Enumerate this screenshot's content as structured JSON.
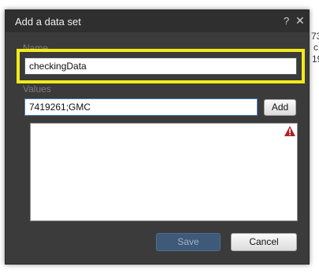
{
  "background": {
    "fragments": [
      "73",
      "c",
      "19"
    ]
  },
  "dialog": {
    "title": "Add a data set",
    "help_label": "?",
    "close_label": "✕",
    "name": {
      "label": "Name",
      "value": "checkingData"
    },
    "values": {
      "label": "Values",
      "input_value": "7419261;GMC",
      "add_label": "Add",
      "warning_icon": "warning-icon"
    },
    "save_label": "Save",
    "cancel_label": "Cancel"
  },
  "colors": {
    "dialog_bg": "#3b3b3b",
    "titlebar_bg": "#2f2f2f",
    "highlight": "#f2ea1a",
    "save_button": "#3e5a78",
    "warning": "#b02025"
  }
}
